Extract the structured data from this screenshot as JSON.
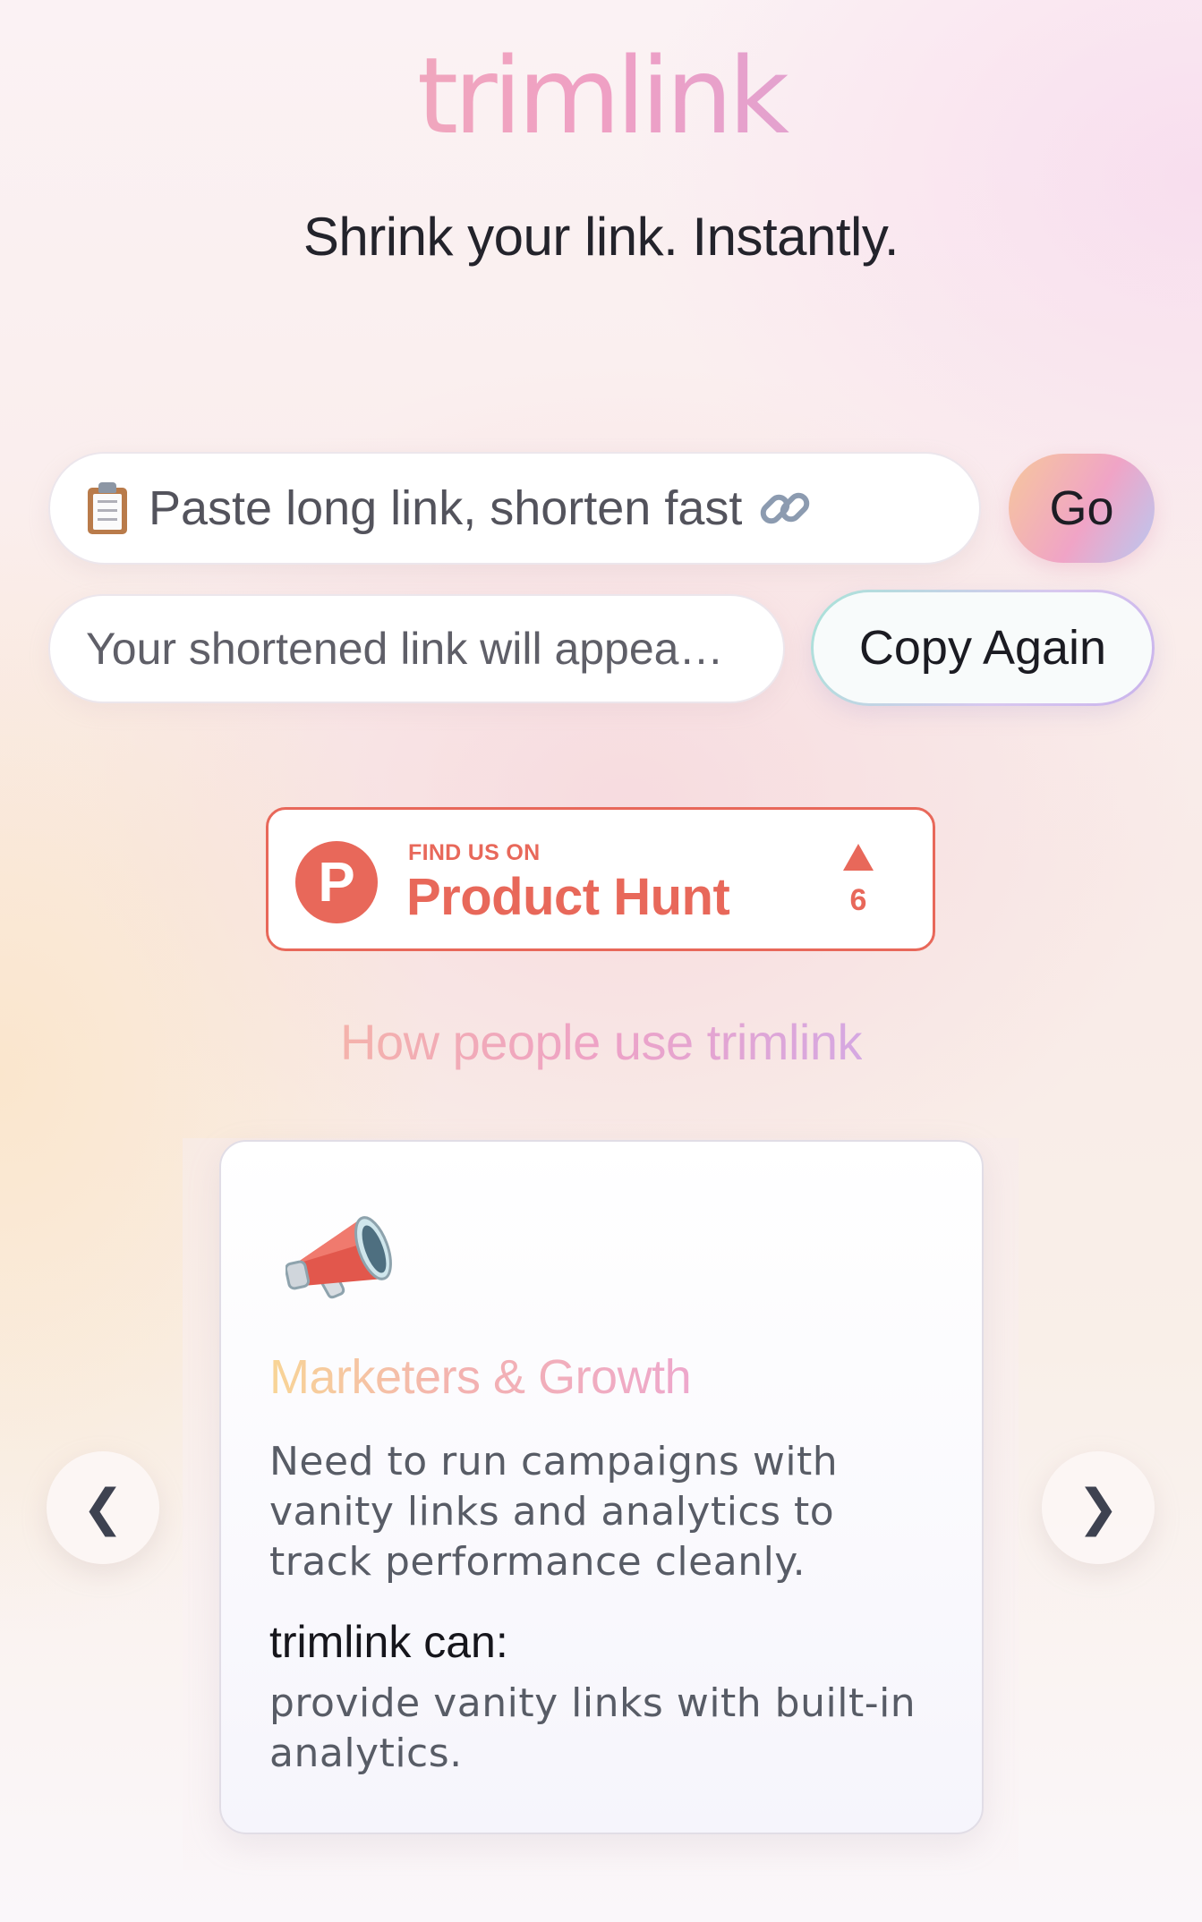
{
  "app": {
    "logo_text": "trimlink",
    "tagline": "Shrink your link. Instantly."
  },
  "shortener": {
    "input_placeholder": "Paste long link, shorten fast",
    "go_label": "Go",
    "output_placeholder": "Your shortened link will appea…",
    "copy_label": "Copy Again"
  },
  "product_hunt": {
    "small_text": "FIND US ON",
    "big_text": "Product Hunt",
    "logo_letter": "P",
    "upvotes": "6"
  },
  "use_cases": {
    "heading": "How people use trimlink",
    "current": {
      "icon": "megaphone-icon",
      "title": "Marketers & Growth",
      "need": "Need to run campaigns with vanity links and analytics to track performance cleanly.",
      "can_heading": "trimlink can:",
      "can": "provide vanity links with built-in analytics."
    },
    "prev_label": "❮",
    "next_label": "❯"
  },
  "colors": {
    "product_hunt": "#e8685a",
    "text_dark": "#23232b",
    "text_muted": "#585c66"
  }
}
